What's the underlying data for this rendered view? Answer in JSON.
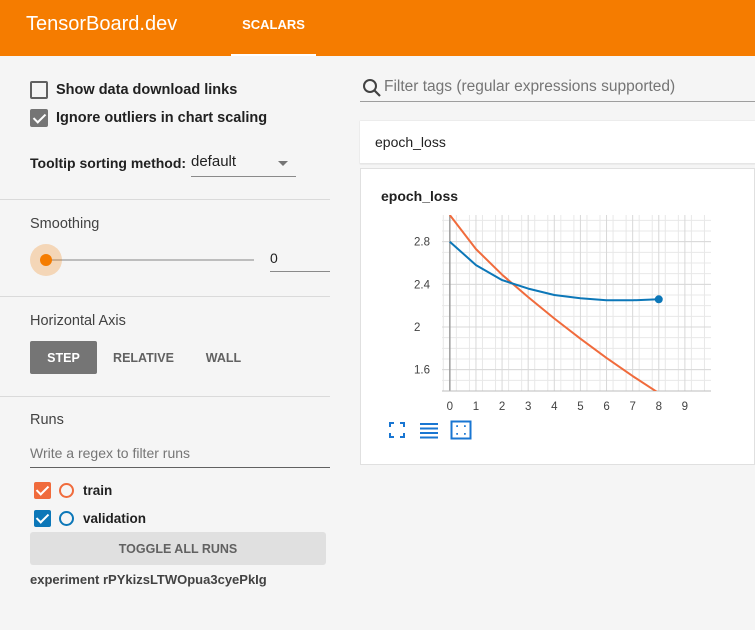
{
  "header": {
    "brand": "TensorBoard.dev",
    "tabs": [
      {
        "label": "SCALARS",
        "active": true
      }
    ],
    "color": "#f57c00"
  },
  "sidebar": {
    "show_download_links": {
      "label": "Show data download links",
      "checked": false
    },
    "ignore_outliers": {
      "label": "Ignore outliers in chart scaling",
      "checked": true
    },
    "tooltip": {
      "label": "Tooltip sorting method:",
      "value": "default"
    },
    "smoothing": {
      "label": "Smoothing",
      "value": "0"
    },
    "horizontal_axis": {
      "label": "Horizontal Axis",
      "options": [
        {
          "label": "STEP",
          "active": true
        },
        {
          "label": "RELATIVE",
          "active": false
        },
        {
          "label": "WALL",
          "active": false
        }
      ]
    },
    "runs": {
      "label": "Runs",
      "filter_placeholder": "Write a regex to filter runs",
      "items": [
        {
          "name": "train",
          "color": "#f06b3c",
          "checked": true
        },
        {
          "name": "validation",
          "color": "#0c77b8",
          "checked": true
        }
      ],
      "toggle_label": "TOGGLE ALL RUNS"
    },
    "experiment": "experiment rPYkizsLTWOpua3cyePkIg",
    "accent_color": "#f57c00",
    "checkbox_color": "#757575"
  },
  "main": {
    "search_placeholder": "Filter tags (regular expressions supported)",
    "group_title": "epoch_loss",
    "card_title": "epoch_loss"
  },
  "chart_data": {
    "type": "line",
    "title": "epoch_loss",
    "xlim": [
      -0.3,
      10
    ],
    "ylim": [
      1.4,
      3.05
    ],
    "x_ticks": [
      0,
      1,
      2,
      3,
      4,
      5,
      6,
      7,
      8,
      9
    ],
    "y_ticks": [
      1.6,
      2,
      2.4,
      2.8
    ],
    "y_tick_labels": [
      "1.6",
      "2",
      "2.4",
      "2.8"
    ],
    "grid": true,
    "series": [
      {
        "name": "train",
        "color": "#f06b3c",
        "x": [
          0,
          1,
          2,
          3,
          4,
          5,
          6,
          7,
          8,
          8.45
        ],
        "y": [
          3.05,
          2.73,
          2.49,
          2.28,
          2.08,
          1.89,
          1.71,
          1.54,
          1.38,
          1.3
        ]
      },
      {
        "name": "validation",
        "color": "#0c77b8",
        "x": [
          0,
          1,
          2,
          3,
          4,
          5,
          6,
          7,
          8
        ],
        "y": [
          2.8,
          2.58,
          2.44,
          2.36,
          2.3,
          2.27,
          2.25,
          2.25,
          2.26
        ],
        "end_marker": true
      }
    ]
  }
}
